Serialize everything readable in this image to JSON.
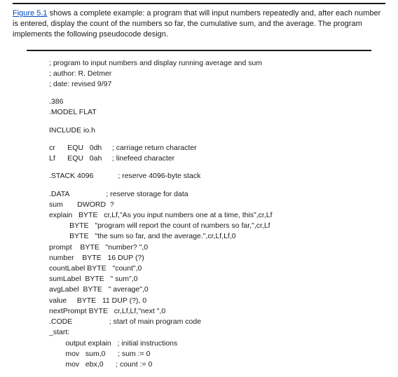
{
  "intro": {
    "link_text": "Figure 5.1",
    "rest": " shows a complete example: a program that will input numbers repeatedly and, after each number is entered, display the count of the numbers so far, the cumulative sum, and the average. The program implements the following pseudocode design."
  },
  "code_lines": [
    "; program to input numbers and display running average and sum",
    "; author: R. Detmer",
    "; date: revised 9/97",
    "",
    ".386",
    ".MODEL FLAT",
    "",
    "INCLUDE io.h",
    "",
    "cr      EQU   0dh     ; carriage return character",
    "Lf      EQU   0ah     ; linefeed character",
    "",
    ".STACK 4096            ; reserve 4096-byte stack",
    "",
    ".DATA                  ; reserve storage for data",
    "sum       DWORD  ?",
    "explain   BYTE   cr,Lf,\"As you input numbers one at a time, this\",cr,Lf",
    "          BYTE   \"program will report the count of numbers so far,\",cr,Lf",
    "          BYTE   \"the sum so far, and the average.\",cr,Lf,Lf,0",
    "prompt    BYTE   \"number? \",0",
    "number    BYTE   16 DUP (?)",
    "countLabel BYTE   \"count\",0",
    "sumLabel  BYTE   \" sum\",0",
    "avgLabel  BYTE   \" average\",0",
    "value     BYTE   11 DUP (?), 0",
    "nextPrompt BYTE   cr,Lf,Lf,\"next \",0",
    ".CODE                  ; start of main program code",
    "_start:",
    "        output explain   ; initial instructions",
    "        mov   sum,0      ; sum := 0",
    "        mov   ebx,0      ; count := 0"
  ]
}
